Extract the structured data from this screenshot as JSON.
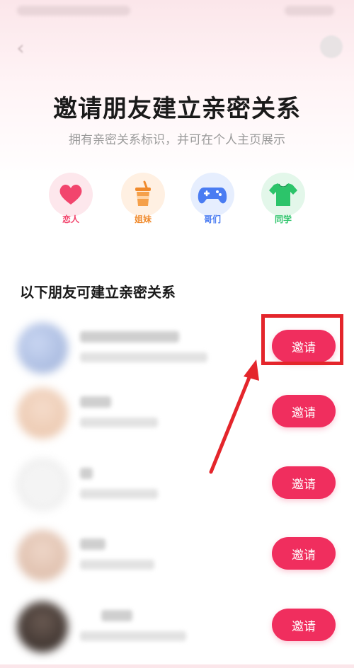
{
  "page": {
    "title": "邀请朋友建立亲密关系",
    "subtitle": "拥有亲密关系标识，并可在个人主页展示"
  },
  "relationship_types": [
    {
      "label": "恋人",
      "icon": "heart-icon",
      "color": "#f2456d",
      "bg": "#fde7ec"
    },
    {
      "label": "姐妹",
      "icon": "drink-cup-icon",
      "color": "#f08a2c",
      "bg": "#fff0e2"
    },
    {
      "label": "哥们",
      "icon": "gamepad-icon",
      "color": "#4a7cf2",
      "bg": "#e6eefe"
    },
    {
      "label": "同学",
      "icon": "tshirt-icon",
      "color": "#2cc46a",
      "bg": "#e3f7ea"
    }
  ],
  "friends_section": {
    "title": "以下朋友可建立亲密关系"
  },
  "friends": [
    {
      "invite_label": "邀请"
    },
    {
      "invite_label": "邀请"
    },
    {
      "invite_label": "邀请"
    },
    {
      "invite_label": "邀请"
    },
    {
      "invite_label": "邀请"
    }
  ],
  "colors": {
    "accent": "#f02e5e",
    "annotation": "#e4252b"
  }
}
